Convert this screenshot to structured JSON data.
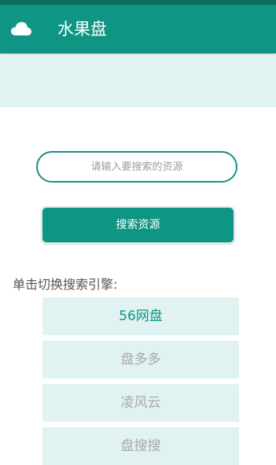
{
  "app_bar": {
    "title": "水果盘",
    "icon": "cloud-icon"
  },
  "search": {
    "placeholder": "请输入要搜索的资源",
    "value": "",
    "button_label": "搜索资源"
  },
  "engines": {
    "heading": "单击切换搜索引擎:",
    "items": [
      {
        "label": "56网盘",
        "active": true
      },
      {
        "label": "盘多多",
        "active": false
      },
      {
        "label": "凌风云",
        "active": false
      },
      {
        "label": "盘搜搜",
        "active": false
      }
    ]
  },
  "colors": {
    "primary": "#0e9584",
    "status_bar": "#0b6b5f",
    "light_panel": "#e0f2f1",
    "inactive_text": "#aaaaaa"
  }
}
